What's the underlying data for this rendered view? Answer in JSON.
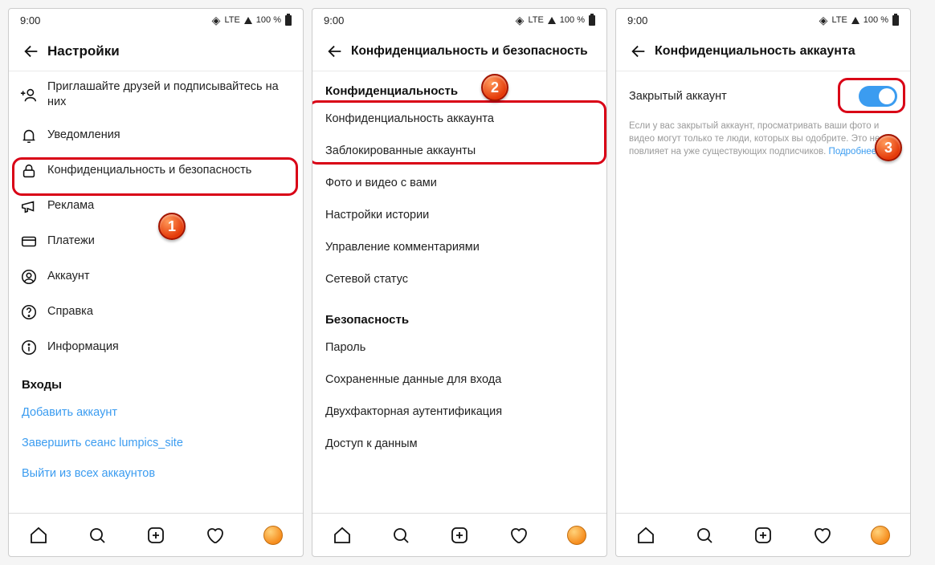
{
  "status": {
    "time": "9:00",
    "net": "LTE",
    "battery": "100 %"
  },
  "screen1": {
    "title": "Настройки",
    "items": [
      {
        "icon": "add-user",
        "label": "Приглашайте друзей и подписывайтесь на них"
      },
      {
        "icon": "bell",
        "label": "Уведомления"
      },
      {
        "icon": "lock",
        "label": "Конфиденциальность и безопасность"
      },
      {
        "icon": "megaphone",
        "label": "Реклама"
      },
      {
        "icon": "card",
        "label": "Платежи"
      },
      {
        "icon": "user",
        "label": "Аккаунт"
      },
      {
        "icon": "help",
        "label": "Справка"
      },
      {
        "icon": "info",
        "label": "Информация"
      }
    ],
    "section": "Входы",
    "links": [
      "Добавить аккаунт",
      "Завершить сеанс lumpics_site",
      "Выйти из всех аккаунтов"
    ],
    "callout": "1"
  },
  "screen2": {
    "title": "Конфиденциальность и безопасность",
    "section1": "Конфиденциальность",
    "items1": [
      "Конфиденциальность аккаунта",
      "Заблокированные аккаунты",
      "Фото и видео с вами",
      "Настройки истории",
      "Управление комментариями",
      "Сетевой статус"
    ],
    "section2": "Безопасность",
    "items2": [
      "Пароль",
      "Сохраненные данные для входа",
      "Двухфакторная аутентификация",
      "Доступ к данным"
    ],
    "callout": "2"
  },
  "screen3": {
    "title": "Конфиденциальность аккаунта",
    "toggleLabel": "Закрытый аккаунт",
    "desc": "Если у вас закрытый аккаунт, просматривать ваши фото и видео могут только те люди, которых вы одобрите. Это не повлияет на уже существующих подписчиков. ",
    "more": "Подробнее",
    "callout": "3"
  }
}
